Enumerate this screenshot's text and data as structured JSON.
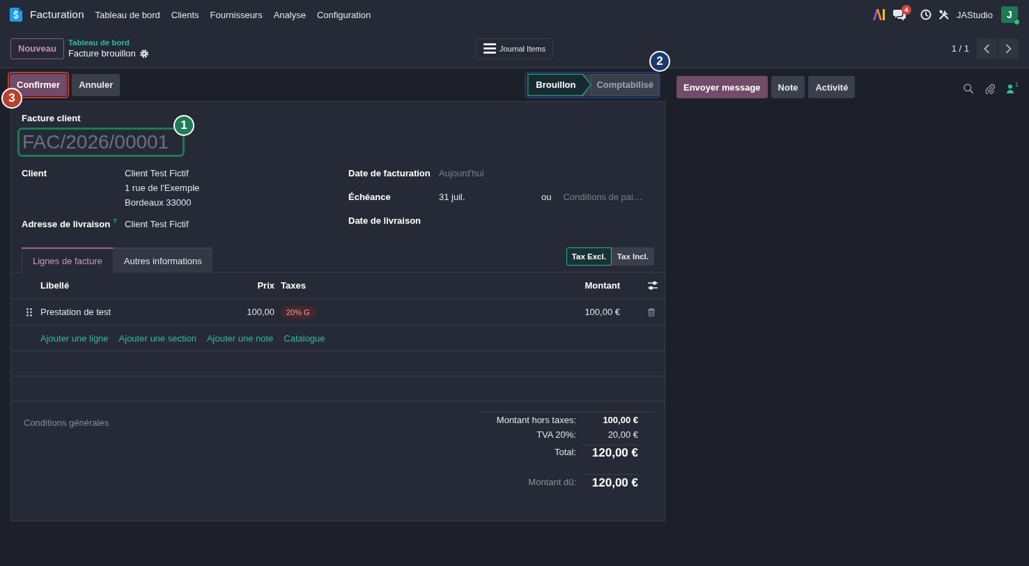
{
  "navbar": {
    "app_name": "Facturation",
    "menu": [
      "Tableau de bord",
      "Clients",
      "Fournisseurs",
      "Analyse",
      "Configuration"
    ],
    "unread_messages": "4",
    "user_name": "JAStudio",
    "avatar_initial": "J",
    "online": true
  },
  "control_panel": {
    "new_button": "Nouveau",
    "breadcrumb": "Tableau de bord",
    "title": "Facture brouillon",
    "journal_button": "Journal Items",
    "pager": "1 / 1"
  },
  "action_buttons": [
    {
      "label": "Confirmer",
      "kind": "primary"
    },
    {
      "label": "Annuler",
      "kind": "secondary"
    }
  ],
  "status_bar": [
    {
      "label": "Brouillon",
      "selected": true
    },
    {
      "label": "Comptabilisé",
      "selected": false
    }
  ],
  "chatter": {
    "buttons": [
      {
        "label": "Envoyer message",
        "kind": "primary"
      },
      {
        "label": "Note",
        "kind": "secondary"
      },
      {
        "label": "Activité",
        "kind": "secondary"
      }
    ],
    "followers": "1"
  },
  "form": {
    "type_label": "Facture client",
    "name_placeholder": "FAC/2026/00001",
    "left_fields": [
      {
        "label": "Client",
        "lines": [
          "Client Test Fictif",
          "1 rue de l'Exemple",
          "Bordeaux 33000"
        ]
      },
      {
        "label": "Adresse de livraison",
        "help": "?",
        "lines": [
          "Client Test Fictif"
        ]
      }
    ],
    "right_fields": [
      {
        "label": "Date de facturation",
        "placeholder": "Aujourd'hui"
      },
      {
        "label": "Échéance",
        "value": "31 juil.",
        "separator": "ou",
        "terms_placeholder": "Conditions de pai…"
      },
      {
        "label": "Date de livraison"
      }
    ],
    "tabs": [
      {
        "label": "Lignes de facture",
        "selected": true
      },
      {
        "label": "Autres informations",
        "selected": false
      }
    ],
    "tax_toggle": [
      {
        "label": "Tax Excl.",
        "selected": true
      },
      {
        "label": "Tax Incl.",
        "selected": false
      }
    ],
    "table": {
      "columns": [
        "Libellé",
        "Prix",
        "Taxes",
        "Montant"
      ],
      "rows": [
        {
          "label": "Prestation de test",
          "price": "100,00",
          "taxes": [
            "20% G"
          ],
          "amount": "100,00 €"
        }
      ],
      "add_links": [
        "Ajouter une ligne",
        "Ajouter une section",
        "Ajouter une note",
        "Catalogue"
      ]
    },
    "terms_placeholder": "Conditions générales",
    "totals": [
      {
        "label": "Montant hors taxes:",
        "value": "100,00 €",
        "kind": "subtotal"
      },
      {
        "label": "TVA 20%:",
        "value": "20,00 €",
        "kind": "tax"
      },
      {
        "label": "Total:",
        "value": "120,00 €",
        "kind": "total"
      },
      {
        "label": "Montant dû:",
        "value": "120,00 €",
        "kind": "due"
      }
    ]
  },
  "callouts": [
    {
      "number": "1",
      "color": "#1f7a55",
      "kind": "name-field"
    },
    {
      "number": "2",
      "color": "#1d3a6c",
      "kind": "status-bar"
    },
    {
      "number": "3",
      "color": "#b8412f",
      "kind": "action-button"
    }
  ]
}
